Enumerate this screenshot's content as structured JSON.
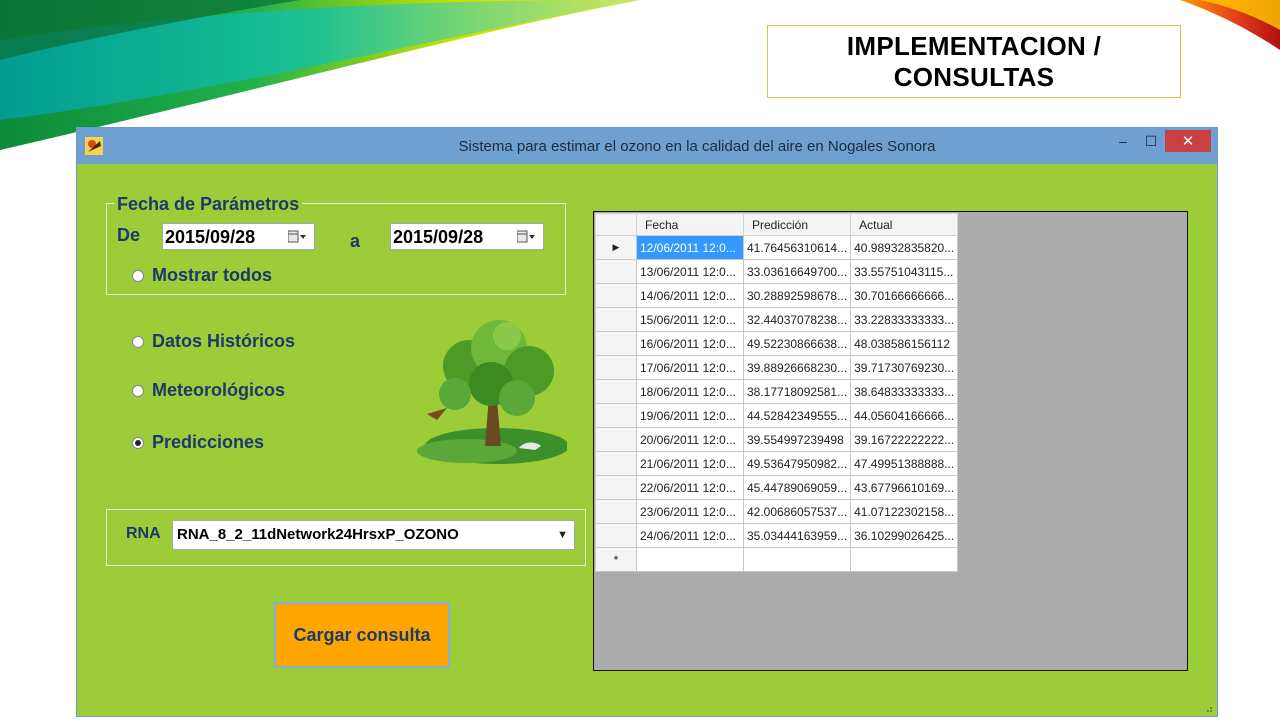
{
  "slide": {
    "title_lines": [
      "IMPLEMENTACION /",
      "CONSULTAS"
    ]
  },
  "window": {
    "title": "Sistema para estimar el ozono  en la calidad del aire en Nogales Sonora",
    "min_symbol": "‒",
    "max_symbol": "☐",
    "close_symbol": "✕"
  },
  "form": {
    "group_label": "Fecha de Parámetros",
    "de_label": "De",
    "a_label": "a",
    "date_from": "2015/09/28",
    "date_to": "2015/09/28",
    "mostrar_todos": "Mostrar todos",
    "radio_historicos": "Datos Históricos",
    "radio_meteo": "Meteorológicos",
    "radio_predicciones": "Predicciones",
    "rna_label": "RNA",
    "rna_selected": "RNA_8_2_11dNetwork24HrsxP_OZONO",
    "cargar_button": "Cargar consulta"
  },
  "grid": {
    "columns": [
      "Fecha",
      "Predicción",
      "Actual"
    ],
    "current_row_marker": "▶",
    "new_row_marker": "*",
    "rows": [
      [
        "12/06/2011 12:0...",
        "41.76456310614...",
        "40.98932835820..."
      ],
      [
        "13/06/2011 12:0...",
        "33.03616649700...",
        "33.55751043115..."
      ],
      [
        "14/06/2011 12:0...",
        "30.28892598678...",
        "30.70166666666..."
      ],
      [
        "15/06/2011 12:0...",
        "32.44037078238...",
        "33.22833333333..."
      ],
      [
        "16/06/2011 12:0...",
        "49.52230866638...",
        "48.038586156112"
      ],
      [
        "17/06/2011 12:0...",
        "39.88926668230...",
        "39.71730769230..."
      ],
      [
        "18/06/2011 12:0...",
        "38.17718092581...",
        "38.64833333333..."
      ],
      [
        "19/06/2011 12:0...",
        "44.52842349555...",
        "44.05604166666..."
      ],
      [
        "20/06/2011 12:0...",
        "39.554997239498",
        "39.16722222222..."
      ],
      [
        "21/06/2011 12:0...",
        "49.53647950982...",
        "47.49951388888..."
      ],
      [
        "22/06/2011 12:0...",
        "45.44789069059...",
        "43.67796610169..."
      ],
      [
        "23/06/2011 12:0...",
        "42.00686057537...",
        "41.07122302158..."
      ],
      [
        "24/06/2011 12:0...",
        "35.03444163959...",
        "36.10299026425..."
      ]
    ]
  },
  "colors": {
    "form_background": "#9ccd38",
    "titlebar": "#6fa0d2",
    "button": "#ffa500",
    "selection": "#3399ff",
    "grid_background": "#ababab"
  }
}
